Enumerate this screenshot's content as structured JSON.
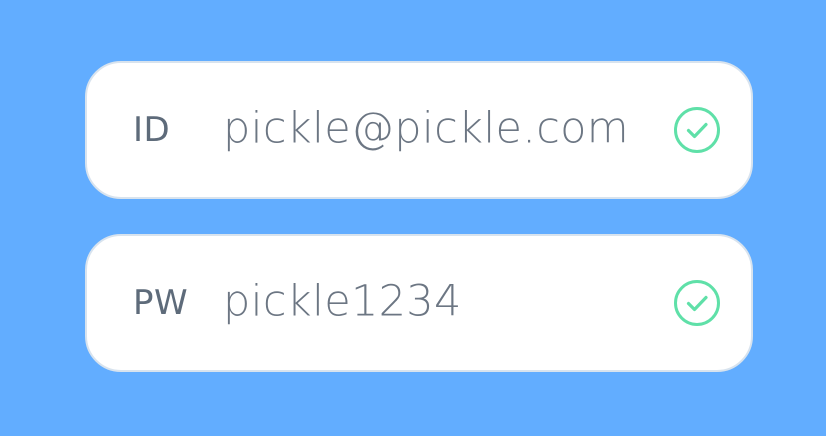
{
  "login": {
    "id_field": {
      "label": "ID",
      "value": "pickle@pickle.com",
      "status_icon": "check-circle-icon"
    },
    "pw_field": {
      "label": "PW",
      "value": "pickle1234",
      "status_icon": "check-circle-icon"
    }
  },
  "colors": {
    "background": "#62adff",
    "field_background": "#ffffff",
    "label_text": "#5e6b7a",
    "value_text": "#6c7683",
    "check": "#5fe0a8"
  }
}
